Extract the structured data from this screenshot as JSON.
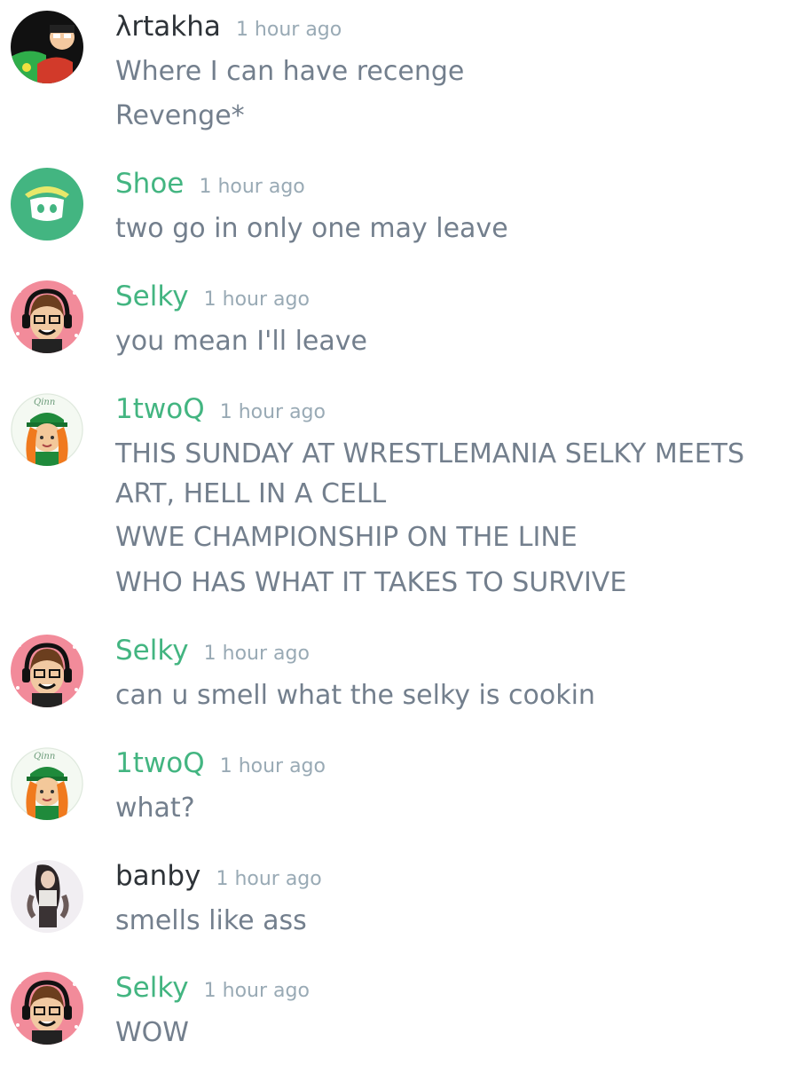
{
  "messages": [
    {
      "author": "λrtakha",
      "timestamp": "1 hour ago",
      "lines": [
        "Where I can have recenge",
        "Revenge*"
      ]
    },
    {
      "author": "Shoe",
      "timestamp": "1 hour ago",
      "lines": [
        "two go in only one may leave"
      ]
    },
    {
      "author": "Selky",
      "timestamp": "1 hour ago",
      "lines": [
        "you mean I'll leave"
      ]
    },
    {
      "author": "1twoQ",
      "timestamp": "1 hour ago",
      "lines": [
        "THIS SUNDAY AT WRESTLEMANIA SELKY MEETS ART, HELL IN A CELL",
        "WWE CHAMPIONSHIP ON THE LINE",
        "WHO HAS WHAT IT TAKES TO SURVIVE"
      ]
    },
    {
      "author": "Selky",
      "timestamp": "1 hour ago",
      "lines": [
        "can u smell what the selky is cookin"
      ]
    },
    {
      "author": "1twoQ",
      "timestamp": "1 hour ago",
      "lines": [
        "what?"
      ]
    },
    {
      "author": "banby",
      "timestamp": "1 hour ago",
      "lines": [
        "smells like ass"
      ]
    },
    {
      "author": "Selky",
      "timestamp": "1 hour ago",
      "lines": [
        "WOW"
      ]
    }
  ],
  "avatar_text": {
    "oqinn": "Qinn"
  },
  "colors": {
    "author_green": "#43b581",
    "author_dark": "#2e3338",
    "message_text": "#737f8d",
    "timestamp": "#99aab5",
    "shoe_avatar_bg": "#43b581"
  }
}
